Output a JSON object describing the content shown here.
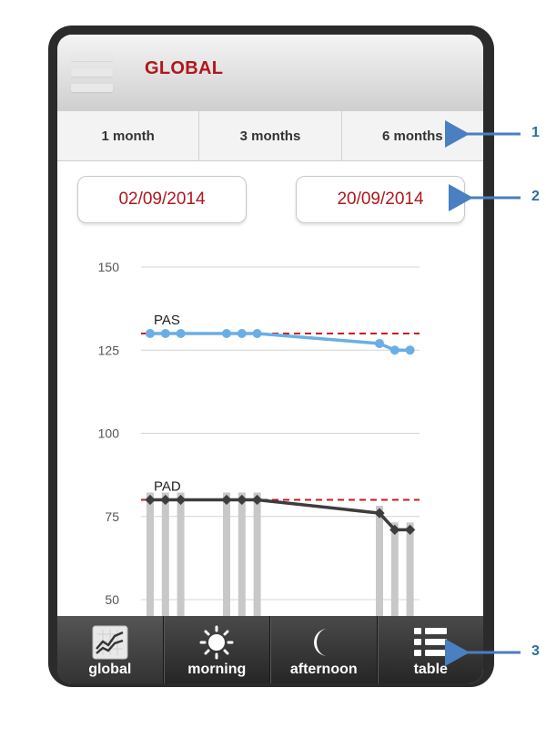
{
  "header": {
    "title": "GLOBAL"
  },
  "ranges": [
    "1 month",
    "3 months",
    "6 months"
  ],
  "dates": {
    "start": "02/09/2014",
    "end": "20/09/2014"
  },
  "chart_data": {
    "type": "line",
    "yticks": [
      150,
      125,
      100,
      75,
      50
    ],
    "ylim": [
      50,
      150
    ],
    "grid": true,
    "series": [
      {
        "name": "PAS",
        "color": "#6aaee8",
        "x": [
          0,
          1,
          2,
          5,
          6,
          7,
          15,
          16,
          17
        ],
        "values": [
          130,
          130,
          130,
          130,
          130,
          130,
          127,
          125,
          125
        ],
        "target": 130,
        "target_color": "#d01818"
      },
      {
        "name": "PAD",
        "color": "#3d3d3d",
        "x": [
          0,
          1,
          2,
          5,
          6,
          7,
          15,
          16,
          17
        ],
        "values": [
          80,
          80,
          80,
          80,
          80,
          80,
          76,
          71,
          71
        ],
        "target": 80,
        "target_color": "#d01818"
      }
    ],
    "bars_color": "#c8c8c8"
  },
  "tabs": [
    {
      "label": "global",
      "icon": "chart-icon"
    },
    {
      "label": "morning",
      "icon": "sun-icon"
    },
    {
      "label": "afternoon",
      "icon": "moon-icon"
    },
    {
      "label": "table",
      "icon": "list-icon"
    }
  ],
  "callouts": [
    "1",
    "2",
    "3"
  ]
}
